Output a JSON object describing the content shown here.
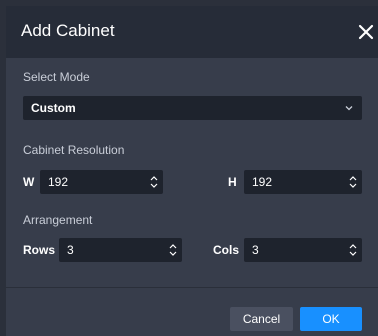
{
  "dialog": {
    "title": "Add Cabinet",
    "close_icon": "close-icon"
  },
  "select_mode": {
    "label": "Select Mode",
    "value": "Custom",
    "chevron_icon": "chevron-down-icon"
  },
  "cabinet_resolution": {
    "label": "Cabinet Resolution",
    "width_label": "W",
    "width_value": "192",
    "height_label": "H",
    "height_value": "192"
  },
  "arrangement": {
    "label": "Arrangement",
    "rows_label": "Rows",
    "rows_value": "3",
    "cols_label": "Cols",
    "cols_value": "3"
  },
  "footer": {
    "cancel_label": "Cancel",
    "ok_label": "OK"
  },
  "colors": {
    "header_bg": "#262c38",
    "body_bg": "#373d4b",
    "input_bg": "#1e232d",
    "primary": "#1890ff"
  }
}
